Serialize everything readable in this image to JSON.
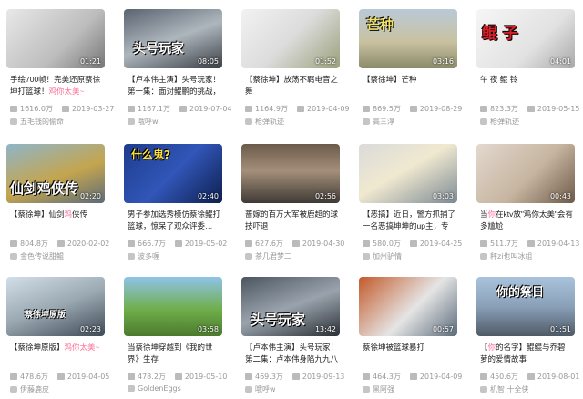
{
  "cards": [
    {
      "title": "手绘700帧！完美还原蔡徐坤打篮球！",
      "title_hl": "鸡你太美~",
      "plays": "1616.0万",
      "date": "2019-03-27",
      "uploader": "五毛钱的偷命",
      "duration": "01:21",
      "overlay": ""
    },
    {
      "title": "【卢本伟主演】头号玩家！第一集：面对鲲鹏的挑战，",
      "title_hl": "",
      "plays": "1167.1万",
      "date": "2019-07-04",
      "uploader": "哦呼w",
      "duration": "08:05",
      "overlay": "头号玩家"
    },
    {
      "title": "【蔡徐坤】放荡不羁电音之舞",
      "title_hl": "",
      "plays": "1164.9万",
      "date": "2019-04-09",
      "uploader": "枪弹轨迹",
      "duration": "01:52",
      "overlay": ""
    },
    {
      "title": "【蔡徐坤】芒种",
      "title_hl": "",
      "plays": "869.5万",
      "date": "2019-08-29",
      "uploader": "高三淳",
      "duration": "03:16",
      "overlay": "芒种"
    },
    {
      "title": "午 夜 鲲 铃",
      "title_hl": "",
      "plays": "823.3万",
      "date": "2019-05-15",
      "uploader": "枪弹轨迹",
      "duration": "04:01",
      "overlay": "鲲 子"
    },
    {
      "title": "【蔡徐坤】仙剑",
      "title_hl": "鸡",
      "title_tail": "侠传",
      "plays": "804.8万",
      "date": "2020-02-02",
      "uploader": "金色传说甜鲲",
      "duration": "02:20",
      "overlay": "仙剑鸡侠传"
    },
    {
      "title": "男子参加选秀模仿蔡徐鲲打篮球，惊呆了观众评委…",
      "title_hl": "",
      "plays": "666.7万",
      "date": "2019-05-02",
      "uploader": "波多喱",
      "duration": "02:40",
      "overlay": "什么鬼?"
    },
    {
      "title": "蔷嫁的百万大军被鹿超的球技吓退",
      "title_hl": "",
      "plays": "627.6万",
      "date": "2019-04-30",
      "uploader": "茶几君梦二",
      "duration": "02:56",
      "overlay": ""
    },
    {
      "title": "【恶搞】近日，警方抓捕了一名恶搞坤坤的up主，专家",
      "title_hl": "",
      "plays": "580.0万",
      "date": "2019-04-25",
      "uploader": "加州驴情",
      "duration": "03:03",
      "overlay": ""
    },
    {
      "title": "当",
      "title_hl": "你",
      "title_tail": "在ktv放\"鸡你太美\"会有多尴尬",
      "plays": "511.7万",
      "date": "2019-04-13",
      "uploader": "秤zi也叫冰组",
      "duration": "00:43",
      "overlay": ""
    },
    {
      "title": "【蔡徐坤原版】",
      "title_hl": "鸡你太美~",
      "plays": "478.6万",
      "date": "2019-04-05",
      "uploader": "伊藤鹿皮",
      "duration": "02:23",
      "overlay": "蔡徐坤原版"
    },
    {
      "title": "当蔡徐坤穿越到《我的世界》生存",
      "title_hl": "",
      "plays": "478.2万",
      "date": "2019-05-10",
      "uploader": "GoldenEggs",
      "duration": "03:58",
      "overlay": ""
    },
    {
      "title": "【卢本伟主演】头号玩家！第二集：卢本伟身陷九九八",
      "title_hl": "",
      "plays": "469.3万",
      "date": "2019-09-13",
      "uploader": "哦呼w",
      "duration": "13:42",
      "overlay": "头号玩家"
    },
    {
      "title": "蔡徐坤被篮球暴打",
      "title_hl": "",
      "plays": "464.3万",
      "date": "2019-04-09",
      "uploader": "黑阿强",
      "duration": "00:57",
      "overlay": ""
    },
    {
      "title": "【",
      "title_hl": "你",
      "title_tail": "的名字】鲲鲲与乔碧萝的爱情故事",
      "plays": "450.6万",
      "date": "2019-08-01",
      "uploader": "机智 十全侠",
      "duration": "01:51",
      "overlay": "你的祭日"
    }
  ],
  "colors": {
    "accent": "#fb7299",
    "meta": "#999999"
  }
}
